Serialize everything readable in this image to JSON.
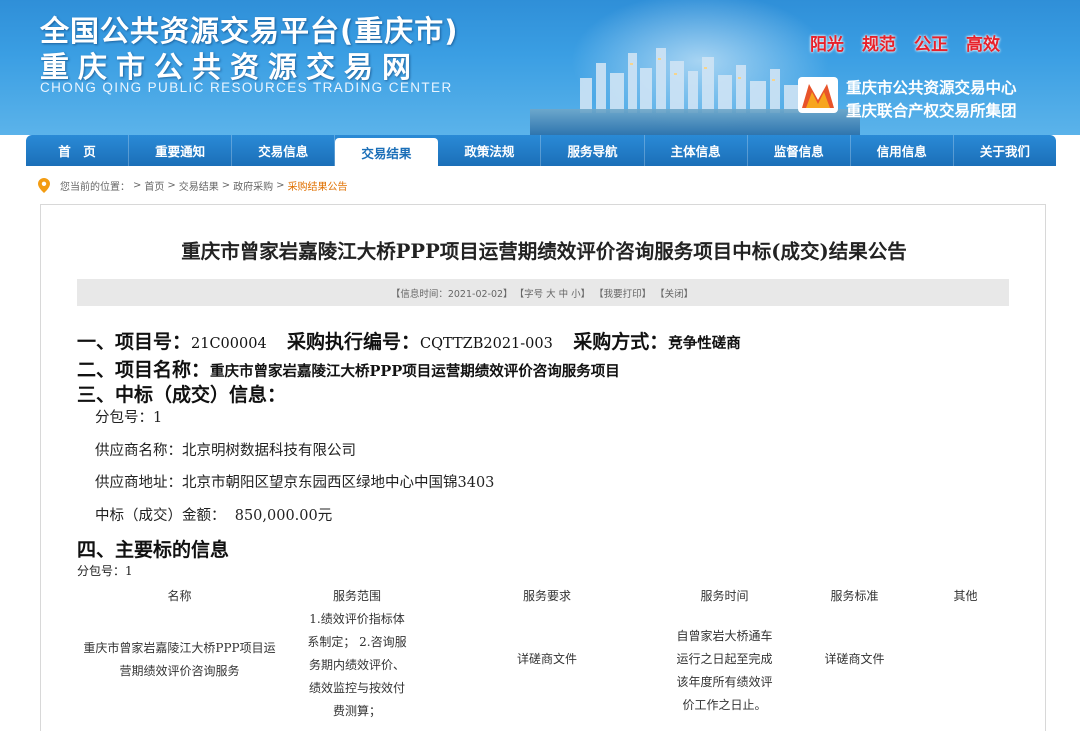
{
  "header": {
    "title_line1": "全国公共资源交易平台(重庆市)",
    "title_line2": "重庆市公共资源交易网",
    "title_en": "CHONG QING PUBLIC RESOURCES TRADING CENTER",
    "slogans": [
      "阳光",
      "规范",
      "公正",
      "高效"
    ],
    "org_line1": "重庆市公共资源交易中心",
    "org_line2": "重庆联合产权交易所集团",
    "slogan_color": "#e8212a"
  },
  "nav": {
    "items": [
      "首　页",
      "重要通知",
      "交易信息",
      "交易结果",
      "政策法规",
      "服务导航",
      "主体信息",
      "监督信息",
      "信用信息",
      "关于我们"
    ],
    "active_index": 3,
    "bar_color": "#1b6fb8"
  },
  "breadcrumb": {
    "prefix": "您当前的位置：",
    "items": [
      "首页",
      "交易结果",
      "政府采购",
      "采购结果公告"
    ],
    "separator": ">"
  },
  "notice": {
    "title": "重庆市曾家岩嘉陵江大桥PPP项目运营期绩效评价咨询服务项目中标(成交)结果公告",
    "meta": {
      "time": "【信息时间：2021-02-02】",
      "font_size": "【字号 大 中 小】",
      "print": "【我要打印】",
      "close": "【关闭】"
    },
    "sec1": {
      "label_no": "一、项目号：",
      "project_no": "21C00004",
      "label_exec": "采购执行编号：",
      "exec_no": "CQTTZB2021-003",
      "label_method": "采购方式：",
      "method": "竞争性磋商"
    },
    "sec2": {
      "label": "二、项目名称：",
      "name": "重庆市曾家岩嘉陵江大桥PPP项目运营期绩效评价咨询服务项目"
    },
    "sec3": {
      "label": "三、中标（成交）信息：",
      "package_label": "分包号：",
      "package": "1",
      "supplier_label": "供应商名称：",
      "supplier": "北京明树数据科技有限公司",
      "address_label": "供应商地址：",
      "address": "北京市朝阳区望京东园西区绿地中心中国锦3403",
      "amount_label": "中标（成交）金额：",
      "amount": "850,000.00元"
    },
    "sec4": {
      "label": "四、主要标的信息",
      "package_label": "分包号：",
      "package": "1",
      "table": {
        "headers": [
          "名称",
          "服务范围",
          "服务要求",
          "服务时间",
          "服务标准",
          "其他"
        ],
        "row": {
          "name": [
            "重庆市曾家岩嘉陵江大桥PPP项目运",
            "营期绩效评价咨询服务"
          ],
          "scope": [
            "1.绩效评价指标体",
            "系制定； 2.咨询服",
            "务期内绩效评价、",
            "绩效监控与按效付",
            "费测算；"
          ],
          "requirement": "详磋商文件",
          "time": [
            "自曾家岩大桥通车",
            "运行之日起至完成",
            "该年度所有绩效评",
            "价工作之日止。"
          ],
          "standard": "详磋商文件",
          "other": ""
        }
      }
    }
  }
}
